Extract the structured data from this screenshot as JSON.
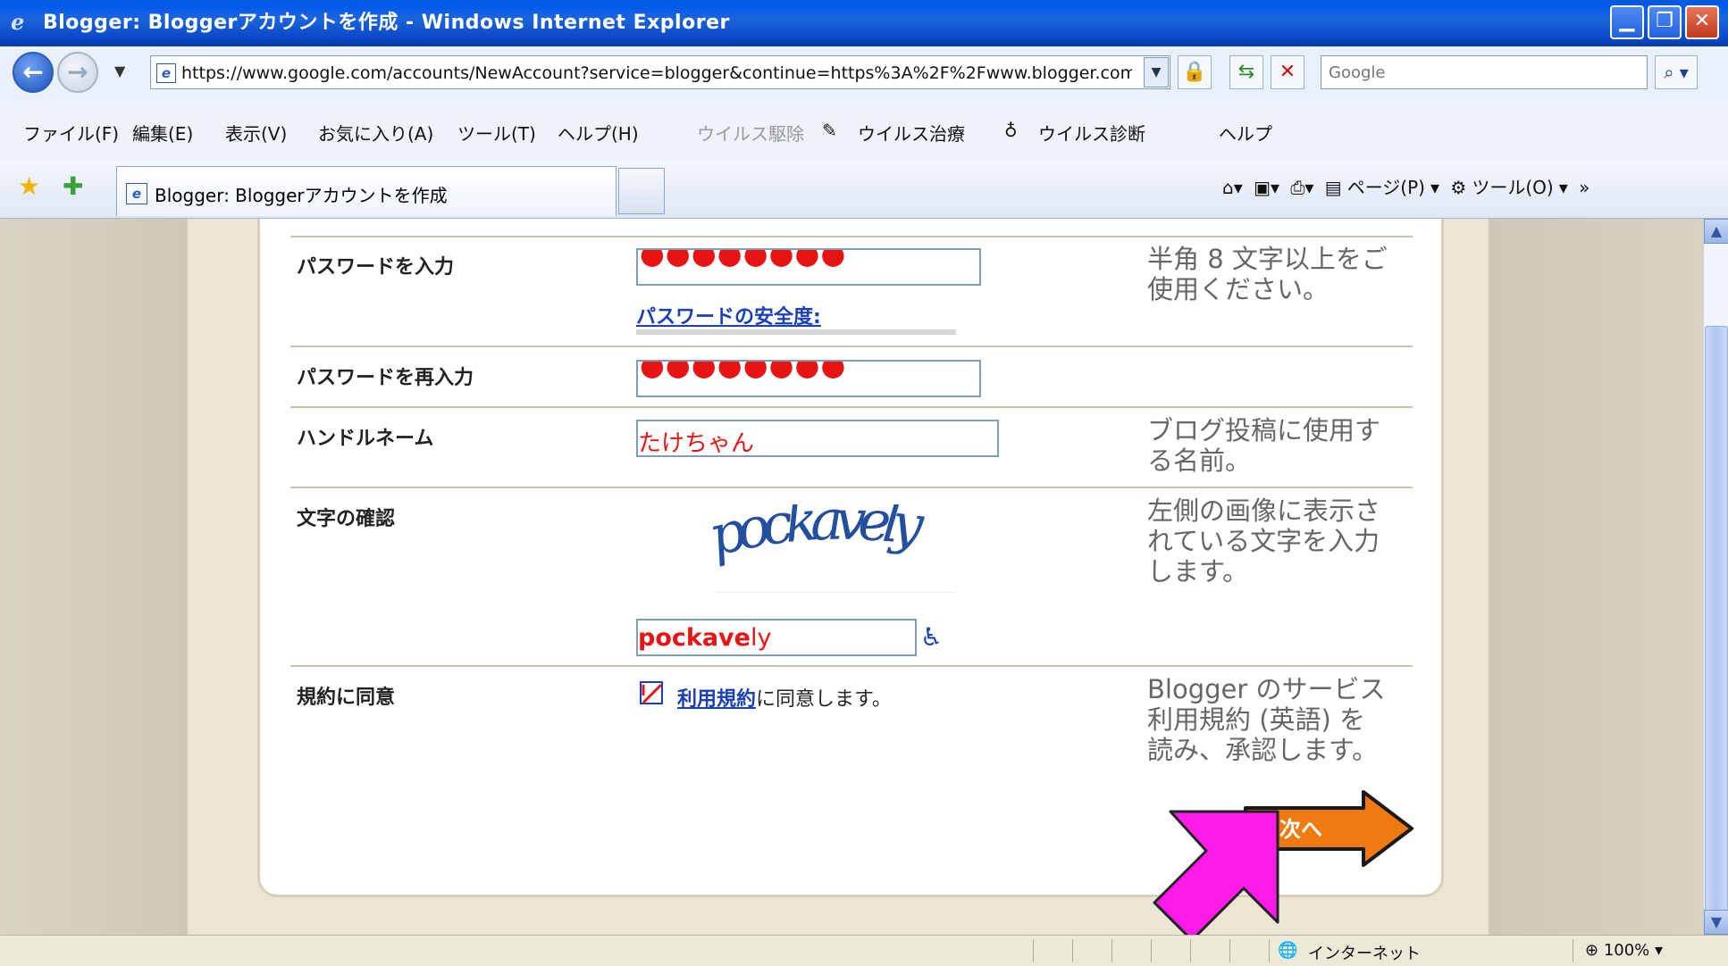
{
  "window": {
    "title": "Blogger: Bloggerアカウントを作成 - Windows Internet Explorer"
  },
  "address": {
    "url": "https://www.google.com/accounts/NewAccount?service=blogger&continue=https%3A%2F%2Fwww.blogger.com%2",
    "search_placeholder": "Google"
  },
  "menu": {
    "file": "ファイル(F)",
    "edit": "編集(E)",
    "view": "表示(V)",
    "favorites": "お気に入り(A)",
    "tools": "ツール(T)",
    "help": "ヘルプ(H)",
    "virus_remove": "ウイルス駆除",
    "virus_treat": "ウイルス治療",
    "virus_diag": "ウイルス診断",
    "help2": "ヘルプ"
  },
  "tab": {
    "title": "Blogger: Bloggerアカウントを作成"
  },
  "commandbar": {
    "page": "ページ(P)",
    "tools": "ツール(O)"
  },
  "form": {
    "password": {
      "label": "パスワードを入力",
      "dots": "●●●●●●●●",
      "strength_link": "パスワードの安全度:",
      "help": "半角 8 文字以上をご使用ください。"
    },
    "password_confirm": {
      "label": "パスワードを再入力",
      "dots": "●●●●●●●●"
    },
    "handle": {
      "label": "ハンドルネーム",
      "value": "たけちゃん",
      "help": "ブログ投稿に使用する名前。"
    },
    "captcha": {
      "label": "文字の確認",
      "image_text": "pockavely",
      "value_part1": "pockave",
      "value_part2": "ly",
      "help": "左側の画像に表示されている文字を入力します。"
    },
    "terms": {
      "label": "規約に同意",
      "link": "利用規約",
      "text": "に同意します。",
      "help": "Blogger のサービス利用規約 (英語) を読み、承認します。"
    },
    "next_button": "次へ"
  },
  "status": {
    "zone": "インターネット",
    "zoom": "100%"
  },
  "colors": {
    "accent_red": "#e81414",
    "next_orange": "#f07a12",
    "pointer_magenta": "#ff1ce8"
  }
}
